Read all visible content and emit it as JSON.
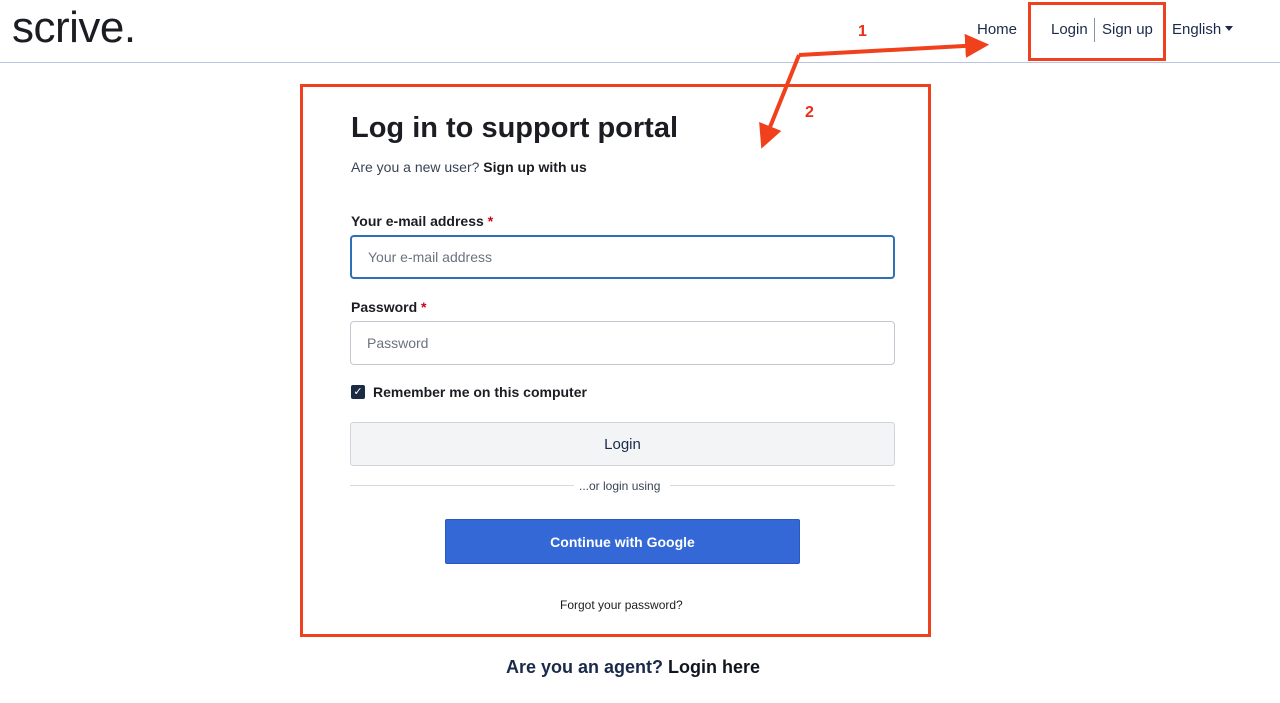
{
  "header": {
    "logo": "scrive.",
    "nav": {
      "home": "Home",
      "login": "Login",
      "signup": "Sign up",
      "language": "English"
    }
  },
  "annotations": {
    "one": "1",
    "two": "2",
    "color": "#ee4120"
  },
  "form": {
    "title": "Log in to support portal",
    "subtitle_prefix": "Are you a new user?",
    "subtitle_link": "Sign up with us",
    "email_label": "Your e-mail address",
    "email_placeholder": "Your e-mail address",
    "password_label": "Password",
    "password_placeholder": "Password",
    "required_mark": "*",
    "remember_label": "Remember me on this computer",
    "remember_checked": true,
    "login_button": "Login",
    "divider_text": "...or login using",
    "google_button": "Continue with Google",
    "forgot_link": "Forgot your password?"
  },
  "footer": {
    "agent_prefix": "Are you an agent?",
    "agent_link": "Login here"
  },
  "colors": {
    "accent": "#3368d6",
    "checkbox": "#1c2b44",
    "focus": "#2f6fb3"
  }
}
